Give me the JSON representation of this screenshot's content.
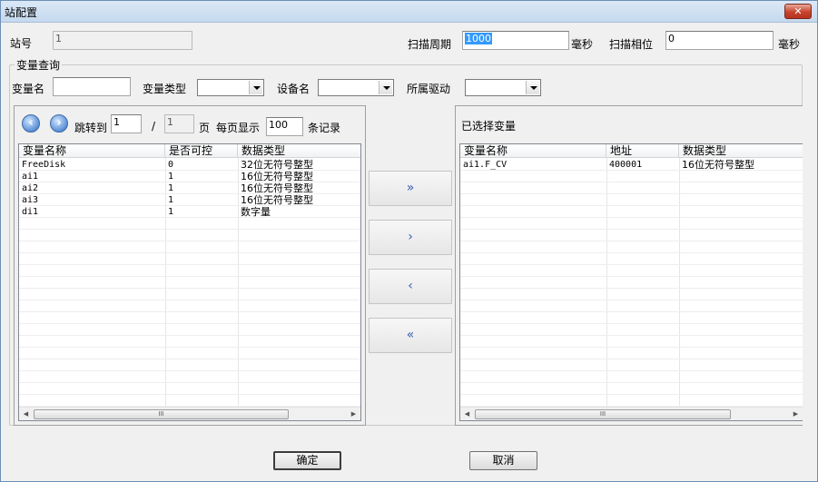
{
  "window": {
    "title": "站配置",
    "close_label": "✕"
  },
  "station": {
    "label": "站号",
    "value": "1"
  },
  "scan": {
    "period_label": "扫描周期",
    "period_value": "1000",
    "period_unit": "毫秒",
    "phase_label": "扫描相位",
    "phase_value": "0",
    "phase_unit": "毫秒"
  },
  "query": {
    "group_label": "变量查询",
    "var_name_label": "变量名",
    "var_name_value": "",
    "var_type_label": "变量类型",
    "var_type_value": "",
    "device_label": "设备名",
    "device_value": "",
    "driver_label": "所属驱动",
    "driver_value": ""
  },
  "paging": {
    "jump_label": "跳转到",
    "page_value": "1",
    "slash": "/",
    "total_pages": "1",
    "page_unit": "页",
    "per_page_label": "每页显示",
    "per_page_value": "100",
    "records_label": "条记录"
  },
  "left_list": {
    "columns": [
      "变量名称",
      "是否可控",
      "数据类型"
    ],
    "rows": [
      [
        "FreeDisk",
        "0",
        "32位无符号整型"
      ],
      [
        "ai1",
        "1",
        "16位无符号整型"
      ],
      [
        "ai2",
        "1",
        "16位无符号整型"
      ],
      [
        "ai3",
        "1",
        "16位无符号整型"
      ],
      [
        "di1",
        "1",
        "数字量"
      ]
    ]
  },
  "move_buttons": {
    "add_all": "»",
    "add_one": "›",
    "remove_one": "‹",
    "remove_all": "«"
  },
  "right_panel": {
    "title": "已选择变量",
    "columns": [
      "变量名称",
      "地址",
      "数据类型"
    ],
    "rows": [
      [
        "ai1.F_CV",
        "400001",
        "16位无符号整型"
      ]
    ]
  },
  "scrollbar": {
    "left_arrow": "◀",
    "right_arrow": "▶",
    "grip": "III"
  },
  "footer": {
    "ok_label": "确定",
    "cancel_label": "取消"
  }
}
